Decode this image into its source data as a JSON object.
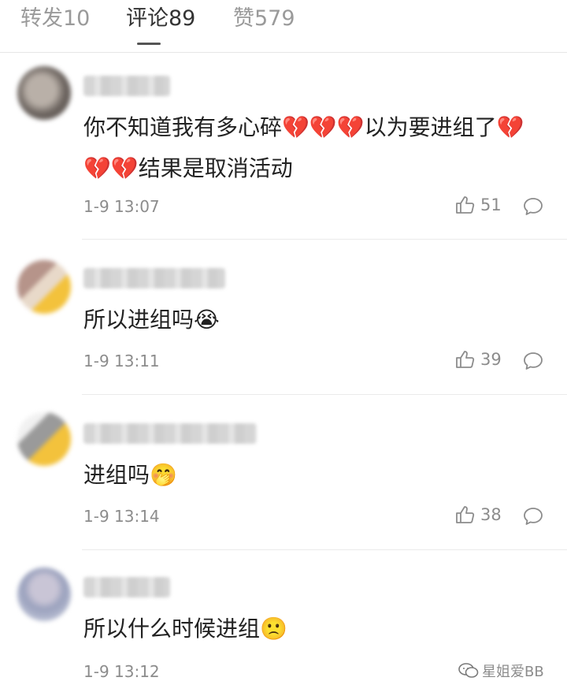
{
  "tabs": [
    {
      "label": "转发10",
      "active": false
    },
    {
      "label": "评论89",
      "active": true
    },
    {
      "label": "赞579",
      "active": false
    }
  ],
  "comments": [
    {
      "text": "你不知道我有多心碎💔💔💔以为要进组了💔💔💔结果是取消活动",
      "time": "1-9 13:07",
      "likes": "51"
    },
    {
      "text": "所以进组吗😭",
      "time": "1-9 13:11",
      "likes": "39"
    },
    {
      "text": "进组吗🤭",
      "time": "1-9 13:14",
      "likes": "38"
    },
    {
      "text": "所以什么时候进组🙁",
      "time": "1-9 13:12",
      "likes": ""
    }
  ],
  "watermark": {
    "text": "星姐爱BB",
    "icon": "wechat-icon"
  },
  "colors": {
    "accent": "#333333",
    "muted": "#8c8c8c",
    "heart": "#d6233c"
  }
}
